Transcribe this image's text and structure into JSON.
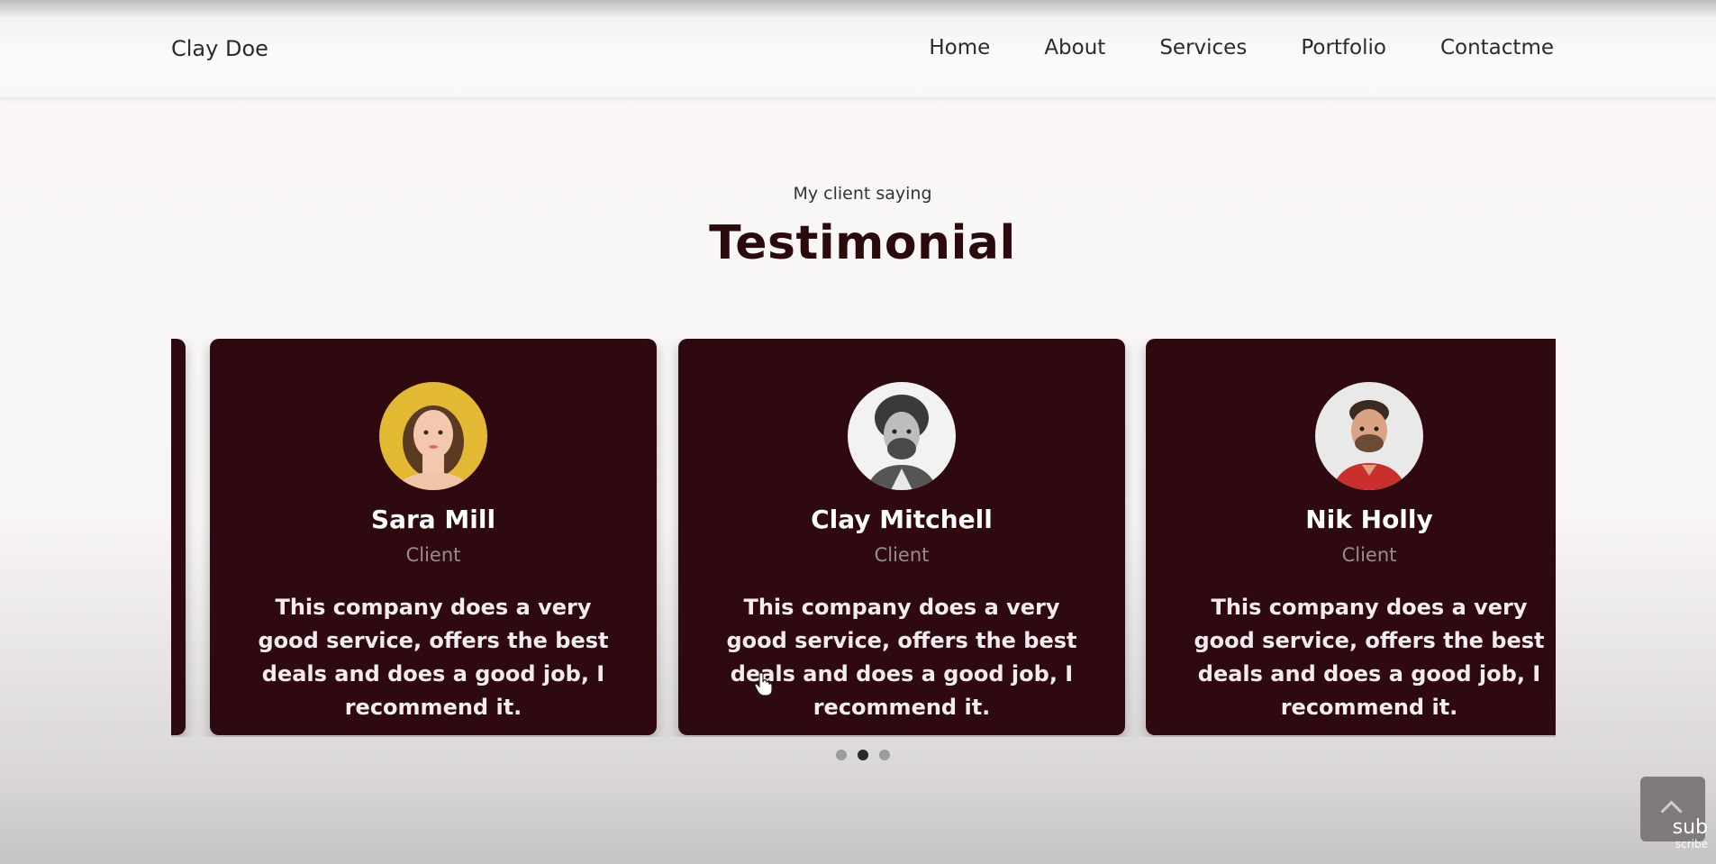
{
  "header": {
    "brand": "Clay Doe",
    "nav": [
      "Home",
      "About",
      "Services",
      "Portfolio",
      "Contactme"
    ]
  },
  "section": {
    "subtitle": "My client saying",
    "title": "Testimonial"
  },
  "testimonials": [
    {
      "name": "Sara Mill",
      "role": "Client",
      "text": "This company does a very good service, offers the best deals and does a good job, I recommend it."
    },
    {
      "name": "Clay Mitchell",
      "role": "Client",
      "text": "This company does a very good service, offers the best deals and does a good job, I recommend it."
    },
    {
      "name": "Nik Holly",
      "role": "Client",
      "text": "This company does a very good service, offers the best deals and does a good job, I recommend it."
    }
  ],
  "carousel": {
    "active_dot": 1
  },
  "watermark": {
    "line1": "sub",
    "line2": "scribe"
  },
  "colors": {
    "card_bg": "#2e0a10",
    "title": "#2a0a0d"
  },
  "icons": {
    "scroll_top": "chevron-up-icon",
    "cursor": "hand-cursor-icon"
  }
}
